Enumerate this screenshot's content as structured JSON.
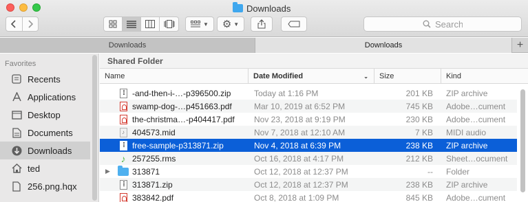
{
  "window": {
    "title": "Downloads"
  },
  "toolbar": {
    "back_icon": "chevron-left-icon",
    "forward_icon": "chevron-right-icon",
    "view_modes": [
      "icon-view",
      "list-view",
      "column-view",
      "cover-flow-view"
    ],
    "selected_view": "list-view",
    "search_placeholder": "Search"
  },
  "tabs": [
    {
      "label": "Downloads",
      "active": false
    },
    {
      "label": "Downloads",
      "active": true
    }
  ],
  "sidebar": {
    "heading": "Favorites",
    "items": [
      {
        "label": "Recents",
        "icon": "recents-icon",
        "active": false
      },
      {
        "label": "Applications",
        "icon": "applications-icon",
        "active": false
      },
      {
        "label": "Desktop",
        "icon": "desktop-icon",
        "active": false
      },
      {
        "label": "Documents",
        "icon": "documents-icon",
        "active": false
      },
      {
        "label": "Downloads",
        "icon": "downloads-icon",
        "active": true
      },
      {
        "label": "ted",
        "icon": "home-icon",
        "active": false
      },
      {
        "label": "256.png.hqx",
        "icon": "file-icon",
        "active": false
      }
    ]
  },
  "path_bar": {
    "label": "Shared Folder"
  },
  "columns": {
    "name": "Name",
    "date": "Date Modified",
    "size": "Size",
    "kind": "Kind"
  },
  "files": [
    {
      "name": "-and-then-i-…-p396500.zip",
      "date": "Today at 1:16 PM",
      "size": "201 KB",
      "kind": "ZIP archive",
      "type": "zip"
    },
    {
      "name": "swamp-dog-…p451663.pdf",
      "date": "Mar 10, 2019 at 6:52 PM",
      "size": "745 KB",
      "kind": "Adobe…cument",
      "type": "pdf"
    },
    {
      "name": "the-christma…-p404417.pdf",
      "date": "Nov 23, 2018 at 9:19 PM",
      "size": "230 KB",
      "kind": "Adobe…cument",
      "type": "pdf"
    },
    {
      "name": "404573.mid",
      "date": "Nov 7, 2018 at 12:10 AM",
      "size": "7 KB",
      "kind": "MIDI audio",
      "type": "mid"
    },
    {
      "name": "free-sample-p313871.zip",
      "date": "Nov 4, 2018 at 6:39 PM",
      "size": "238 KB",
      "kind": "ZIP archive",
      "type": "zip",
      "selected": true
    },
    {
      "name": "257255.rms",
      "date": "Oct 16, 2018 at 4:17 PM",
      "size": "212 KB",
      "kind": "Sheet…ocument",
      "type": "rms"
    },
    {
      "name": "313871",
      "date": "Oct 12, 2018 at 12:37 PM",
      "size": "--",
      "kind": "Folder",
      "type": "folder"
    },
    {
      "name": "313871.zip",
      "date": "Oct 12, 2018 at 12:37 PM",
      "size": "238 KB",
      "kind": "ZIP archive",
      "type": "zip"
    },
    {
      "name": "383842.pdf",
      "date": "Oct 8, 2018 at 1:09 PM",
      "size": "845 KB",
      "kind": "Adobe…cument",
      "type": "pdf"
    }
  ],
  "colors": {
    "selection": "#0b5fd8",
    "folder": "#3fa7ee"
  }
}
